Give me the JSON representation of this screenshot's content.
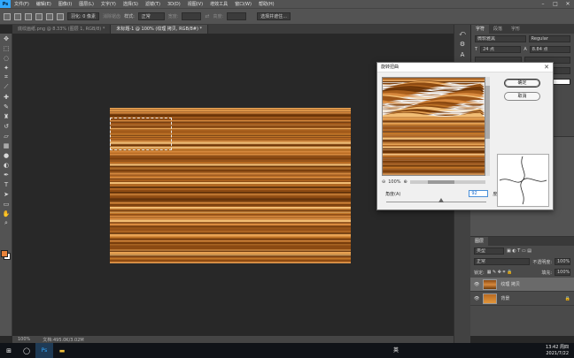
{
  "app": {
    "logo": "Ps",
    "brand_color": "#31a8ff"
  },
  "menu": [
    "文件(F)",
    "编辑(E)",
    "图像(I)",
    "图层(L)",
    "文字(Y)",
    "选择(S)",
    "滤镜(T)",
    "3D(D)",
    "视图(V)",
    "增效工具",
    "窗口(W)",
    "帮助(H)"
  ],
  "options": {
    "feather": "羽化: 0 像素",
    "antialias": "消除锯齿",
    "style_label": "样式:",
    "style_value": "正常",
    "width": "宽度:",
    "height": "高度:",
    "select_mask": "选择并遮住..."
  },
  "tabs": [
    {
      "label": "底纹画纸.png @ 8.33% (图层 1, RGB/8) *",
      "active": false
    },
    {
      "label": "未标题-1 @ 100% (纹理 拷贝, RGB/8#) *",
      "active": true
    }
  ],
  "tools": [
    "move-icon",
    "marquee-icon",
    "lasso-icon",
    "magic-wand-icon",
    "crop-icon",
    "eyedropper-icon",
    "healing-icon",
    "brush-icon",
    "stamp-icon",
    "history-brush-icon",
    "eraser-icon",
    "gradient-icon",
    "blur-icon",
    "dodge-icon",
    "pen-icon",
    "type-icon",
    "path-select-icon",
    "shape-icon",
    "hand-icon",
    "zoom-icon"
  ],
  "foreground_color": "#e8833a",
  "background_color": "#ffffff",
  "status": {
    "zoom": "100%",
    "doc": "文档:495.0K/3.02M"
  },
  "dialog": {
    "title": "旋转扭曲",
    "ok": "确定",
    "cancel": "取消",
    "zoom": "100%",
    "amount_label": "角度(A)",
    "amount_value": "92",
    "amount_unit": "度",
    "slider_value": 0.55
  },
  "panels": {
    "char_tabs": [
      "字符",
      "段落",
      "字形"
    ],
    "font_family": "微软雅黑",
    "font_style": "Regular",
    "font_size": "24 点",
    "leading": "8.84 点",
    "layers_title": "图层",
    "kind": "类型",
    "blend_mode": "正常",
    "opacity_label": "不透明度:",
    "opacity": "100%",
    "lock_label": "锁定:",
    "fill_label": "填充:",
    "fill": "100%",
    "layers": [
      {
        "name": "纹理 拷贝",
        "active": true
      },
      {
        "name": "背景",
        "active": false
      }
    ]
  },
  "taskbar": {
    "ime": "英",
    "time": "13:42 周四",
    "date": "2021/7/22"
  }
}
